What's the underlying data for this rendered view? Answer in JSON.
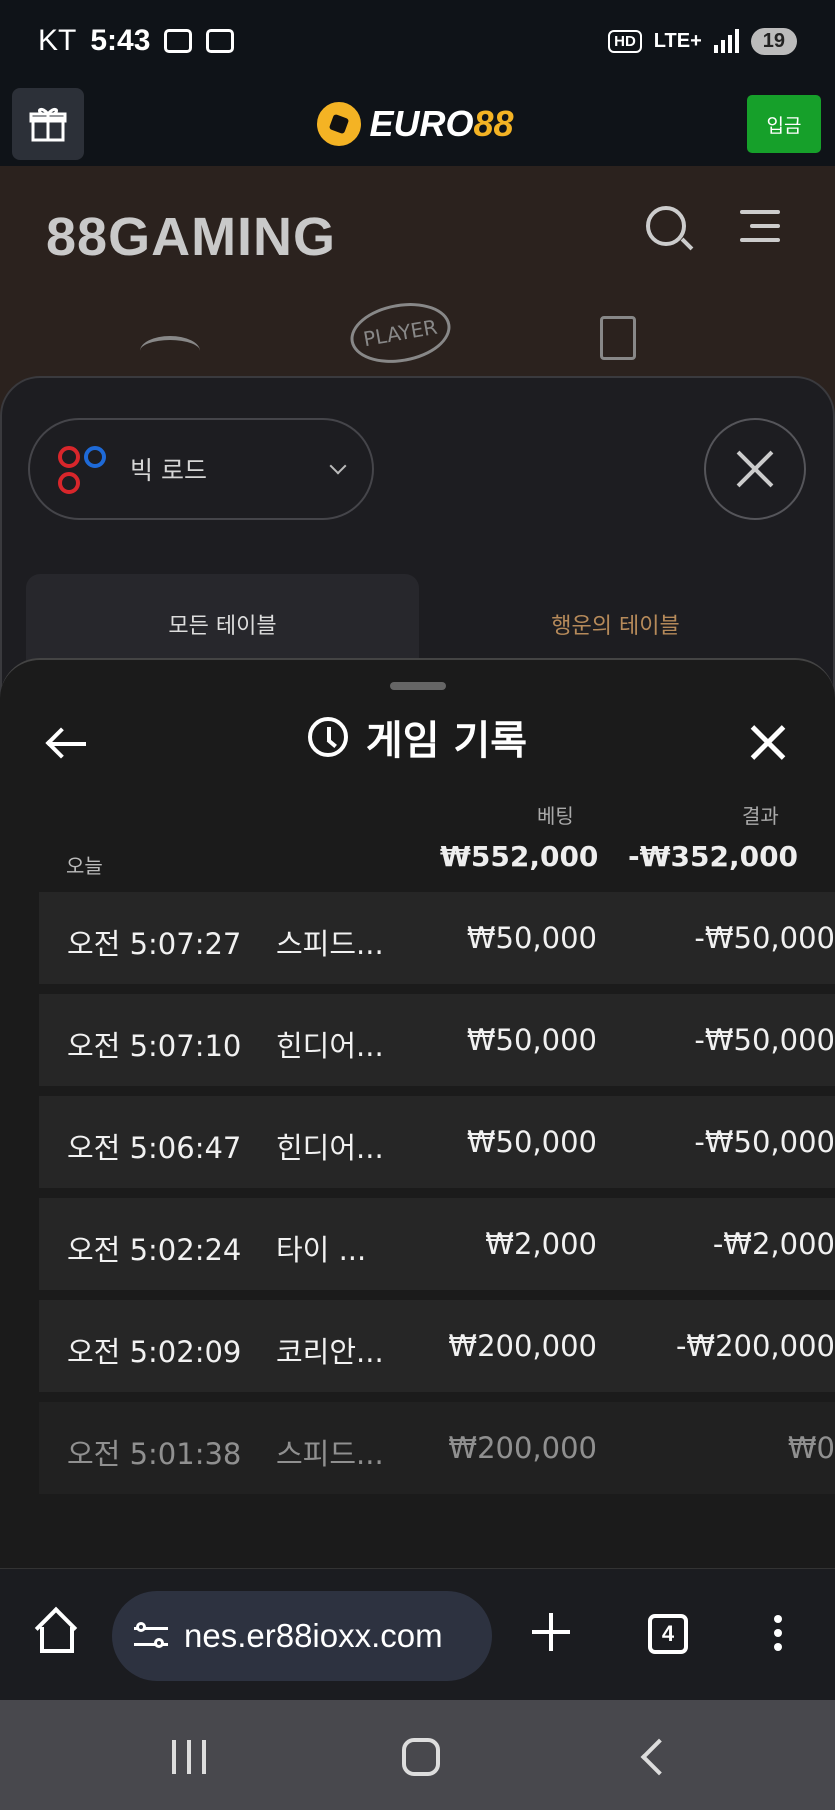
{
  "status_bar": {
    "carrier": "KT",
    "time": "5:43",
    "network": "LTE+",
    "hd": "HD",
    "battery": "19"
  },
  "site_header": {
    "logo_euro": "EURO",
    "logo_88": "88",
    "deposit_label": "입금"
  },
  "gaming_header": {
    "logo_text": "88GAMING",
    "deco_label": "PLAYER"
  },
  "road_panel": {
    "road_select": "빅 로드",
    "tabs": [
      "모든 테이블",
      "행운의 테이블"
    ]
  },
  "history": {
    "title": "게임 기록",
    "col_bet": "베팅",
    "col_result": "결과",
    "date_label": "오늘",
    "total_bet": "₩552,000",
    "total_result": "-₩352,000",
    "rows": [
      {
        "time": "오전 5:07:27",
        "game": "스피드...",
        "bet": "₩50,000",
        "result": "-₩50,000"
      },
      {
        "time": "오전 5:07:10",
        "game": "힌디어...",
        "bet": "₩50,000",
        "result": "-₩50,000"
      },
      {
        "time": "오전 5:06:47",
        "game": "힌디어...",
        "bet": "₩50,000",
        "result": "-₩50,000"
      },
      {
        "time": "오전 5:02:24",
        "game": "타이 ...",
        "bet": "₩2,000",
        "result": "-₩2,000"
      },
      {
        "time": "오전 5:02:09",
        "game": "코리안...",
        "bet": "₩200,000",
        "result": "-₩200,000"
      },
      {
        "time": "오전 5:01:38",
        "game": "스피드...",
        "bet": "₩200,000",
        "result": "₩0"
      }
    ]
  },
  "browser": {
    "url": "nes.er88ioxx.com",
    "tab_count": "4"
  },
  "colors": {
    "deposit_green": "#16a02a",
    "brand_gold": "#f4b324",
    "lucky_tab": "#b68a5a"
  }
}
